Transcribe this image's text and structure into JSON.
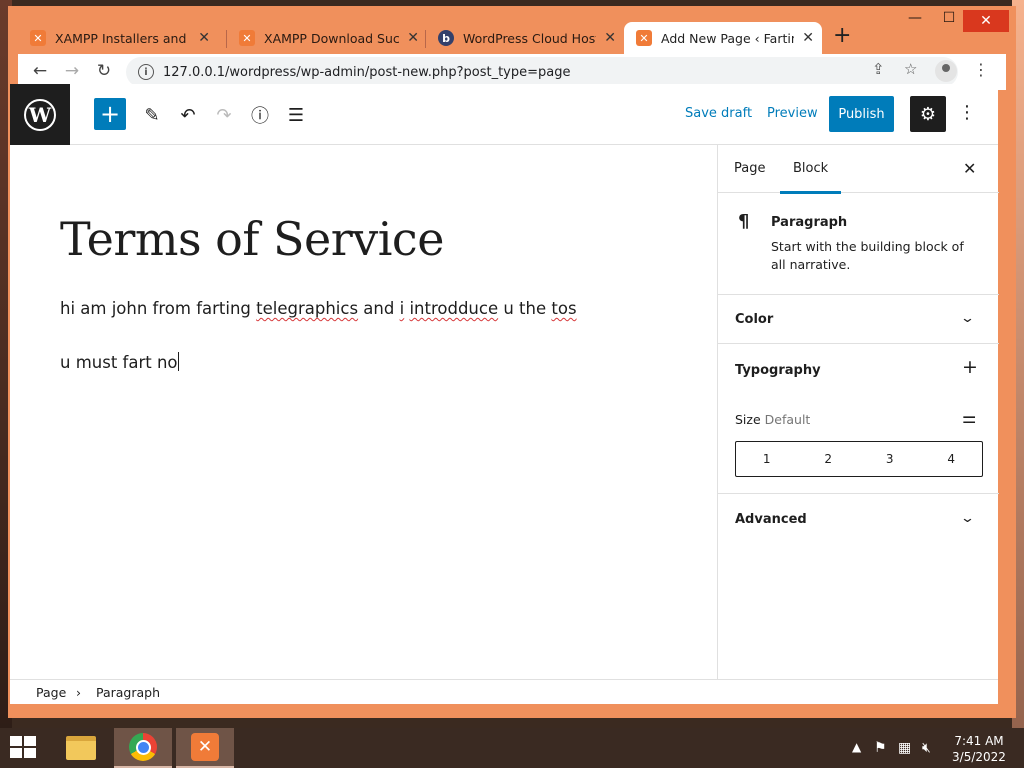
{
  "browser": {
    "tabs": [
      {
        "label": "XAMPP Installers and Do",
        "icon": "xampp-icon"
      },
      {
        "label": "XAMPP Download Succes",
        "icon": "xampp-icon"
      },
      {
        "label": "WordPress Cloud Hosting",
        "icon": "wordpress-hosting-icon"
      },
      {
        "label": "Add New Page ‹ Farting T",
        "icon": "xampp-icon",
        "active": true
      }
    ],
    "url": "127.0.0.1/wordpress/wp-admin/post-new.php?post_type=page",
    "accent_color": "#f0905c"
  },
  "editor": {
    "header": {
      "save_draft": "Save draft",
      "preview": "Preview",
      "publish": "Publish"
    },
    "content": {
      "title": "Terms of Service",
      "paragraph1": {
        "parts": [
          "hi am john from farting ",
          "telegraphics",
          " and ",
          "i",
          " ",
          "introdduce",
          " u the ",
          "tos"
        ]
      },
      "paragraph2": "u must fart no"
    },
    "sidebar": {
      "tabs": [
        "Page",
        "Block"
      ],
      "active_tab": "Block",
      "block": {
        "name": "Paragraph",
        "description": "Start with the building block of all narrative."
      },
      "panels": {
        "color": "Color",
        "typography": "Typography",
        "size_label": "Size",
        "size_value": "Default",
        "size_options": [
          "1",
          "2",
          "3",
          "4"
        ],
        "advanced": "Advanced"
      }
    },
    "breadcrumb": [
      "Page",
      "Paragraph"
    ],
    "brand_color": "#007cba"
  },
  "taskbar": {
    "time": "7:41 AM",
    "date": "3/5/2022"
  }
}
